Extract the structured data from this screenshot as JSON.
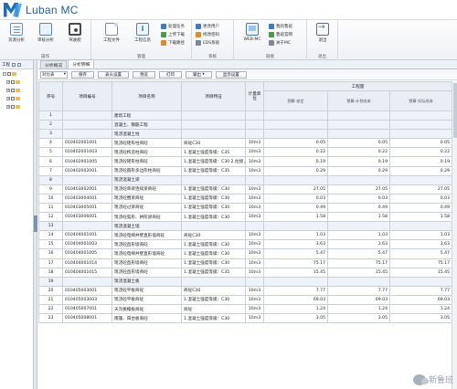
{
  "app": {
    "title": "Luban MC"
  },
  "ribbon": {
    "groups": [
      {
        "label": "操作",
        "buttons": [
          {
            "label": "资源分析"
          },
          {
            "label": "审核分析"
          },
          {
            "label": "驾驶舱"
          }
        ]
      },
      {
        "label": "管理",
        "buttons": [
          {
            "label": "工程文件"
          },
          {
            "label": "工程信息"
          }
        ],
        "small": [
          {
            "label": "处理任务"
          },
          {
            "label": "上传下载"
          },
          {
            "label": "下载路径"
          }
        ]
      },
      {
        "label": "系统",
        "small": [
          {
            "label": "更改用户"
          },
          {
            "label": "修改密码"
          },
          {
            "label": "EDS系统"
          }
        ]
      },
      {
        "label": "链接",
        "buttons": [
          {
            "label": "WEB-MC"
          }
        ],
        "small": [
          {
            "label": "我的鲁班"
          },
          {
            "label": "鲁班官网"
          },
          {
            "label": "关于MC"
          }
        ]
      },
      {
        "label": "退出",
        "buttons": [
          {
            "label": "退出"
          }
        ]
      }
    ]
  },
  "leftpanel": {
    "header": "工程"
  },
  "tabs": [
    {
      "label": "分析概况"
    },
    {
      "label": "分析明细"
    }
  ],
  "toolbar": {
    "select_value": "对比表",
    "buttons": [
      {
        "label": "保存"
      },
      {
        "label": "表头设置"
      },
      {
        "label": "预览"
      },
      {
        "label": "打印"
      },
      {
        "label": "输出"
      },
      {
        "label": "显示设置"
      }
    ]
  },
  "table": {
    "headers": {
      "seq": "序号",
      "code": "项目编号",
      "name": "项目名称",
      "feature": "项目特征",
      "unit": "计量单位",
      "qty_group": "工程量",
      "qty_cols": [
        "预算-核定",
        "预算-计划成本",
        "预算-实际成本"
      ]
    },
    "rows": [
      {
        "seq": "1",
        "code": "",
        "name": "建筑工程",
        "feature": "",
        "unit": "",
        "v1": "",
        "v2": "",
        "v3": "",
        "type": "section"
      },
      {
        "seq": "2",
        "code": "",
        "name": "混凝土、钢筋工程",
        "feature": "",
        "unit": "",
        "v1": "",
        "v2": "",
        "v3": "",
        "type": "section"
      },
      {
        "seq": "3",
        "code": "",
        "name": "现浇混凝土柱",
        "feature": "",
        "unit": "",
        "v1": "",
        "v2": "",
        "v3": "",
        "type": "section"
      },
      {
        "seq": "4",
        "code": "010402001001",
        "name": "现浇砼矩形柱商砼",
        "feature": "商砼C30",
        "unit": "10m3",
        "v1": "0.05",
        "v2": "0.05",
        "v3": "0.05",
        "type": ""
      },
      {
        "seq": "5",
        "code": "010402001003",
        "name": "现浇砼构造柱商砼",
        "feature": "1.混凝土强度等级：C35",
        "unit": "10m3",
        "v1": "0.22",
        "v2": "0.22",
        "v3": "0.22",
        "type": ""
      },
      {
        "seq": "6",
        "code": "010402001005",
        "name": "现浇砼矩形柱商砼",
        "feature": "1.混凝土强度等级：C30 2.拉接，模板柱",
        "unit": "10m3",
        "v1": "0.19",
        "v2": "0.19",
        "v3": "0.19",
        "type": ""
      },
      {
        "seq": "7",
        "code": "010402002001",
        "name": "现浇砼圆形多边形柱商砼",
        "feature": "1.混凝土强度等级：C35",
        "unit": "10m3",
        "v1": "0.29",
        "v2": "0.29",
        "v3": "0.29",
        "type": ""
      },
      {
        "seq": "8",
        "code": "",
        "name": "现浇混凝土梁",
        "feature": "",
        "unit": "",
        "v1": "",
        "v2": "",
        "v3": "",
        "type": "section"
      },
      {
        "seq": "9",
        "code": "010403002001",
        "name": "现浇砼单梁连续梁商砼",
        "feature": "1.混凝土强度等级：C30",
        "unit": "10m3",
        "v1": "27.05",
        "v2": "27.05",
        "v3": "27.05",
        "type": ""
      },
      {
        "seq": "10",
        "code": "010403004001",
        "name": "现浇砼圈梁商砼",
        "feature": "1.混凝土强度等级：C30",
        "unit": "10m3",
        "v1": "0.03",
        "v2": "0.03",
        "v3": "0.03",
        "type": ""
      },
      {
        "seq": "11",
        "code": "010403005001",
        "name": "现浇砼过梁商砼",
        "feature": "1.混凝土强度等级：C30",
        "unit": "10m3",
        "v1": "0.49",
        "v2": "0.49",
        "v3": "0.49",
        "type": ""
      },
      {
        "seq": "12",
        "code": "010403006001",
        "name": "现浇砼弧形、拱形梁商砼",
        "feature": "1.混凝土强度等级：C30",
        "unit": "10m3",
        "v1": "1.58",
        "v2": "1.58",
        "v3": "1.58",
        "type": ""
      },
      {
        "seq": "13",
        "code": "",
        "name": "现浇混凝土墙",
        "feature": "",
        "unit": "",
        "v1": "",
        "v2": "",
        "v3": "",
        "type": "section"
      },
      {
        "seq": "14",
        "code": "010404001001",
        "name": "现浇砼电梯井壁直形墙商砼",
        "feature": "商砼C30",
        "unit": "10m3",
        "v1": "1.03",
        "v2": "1.03",
        "v3": "1.03",
        "type": ""
      },
      {
        "seq": "15",
        "code": "010404001003",
        "name": "现浇砼直形墙商砼",
        "feature": "1.混凝土强度等级：C30",
        "unit": "10m3",
        "v1": "3.63",
        "v2": "3.63",
        "v3": "3.63",
        "type": ""
      },
      {
        "seq": "16",
        "code": "010404001005",
        "name": "现浇砼电梯井壁直形墙商砼",
        "feature": "1.混凝土强度等级：C30",
        "unit": "10m3",
        "v1": "5.47",
        "v2": "5.47",
        "v3": "5.47",
        "type": ""
      },
      {
        "seq": "17",
        "code": "010404001014",
        "name": "现浇砼直形墙商砼",
        "feature": "1.混凝土强度等级：C30",
        "unit": "10m3",
        "v1": "75.17",
        "v2": "75.17",
        "v3": "75.17",
        "type": ""
      },
      {
        "seq": "18",
        "code": "010404001015",
        "name": "现浇砼直形墙商砼",
        "feature": "1.混凝土强度等级：C35",
        "unit": "10m3",
        "v1": "15.45",
        "v2": "15.45",
        "v3": "15.45",
        "type": ""
      },
      {
        "seq": "19",
        "code": "",
        "name": "现浇混凝土板",
        "feature": "",
        "unit": "",
        "v1": "",
        "v2": "",
        "v3": "",
        "type": "section"
      },
      {
        "seq": "20",
        "code": "010405003001",
        "name": "现浇砼平板商砼",
        "feature": "商砼C30",
        "unit": "10m3",
        "v1": "7.77",
        "v2": "7.77",
        "v3": "7.77",
        "type": ""
      },
      {
        "seq": "21",
        "code": "010405003003",
        "name": "现浇砼平板商砼",
        "feature": "1.混凝土强度等级：C30",
        "unit": "10m3",
        "v1": "69.03",
        "v2": "69.03",
        "v3": "69.03",
        "type": ""
      },
      {
        "seq": "22",
        "code": "010405007001",
        "name": "天沟挑檐板商砼",
        "feature": "商砼",
        "unit": "10m3",
        "v1": "1.24",
        "v2": "1.24",
        "v3": "1.24",
        "type": ""
      },
      {
        "seq": "23",
        "code": "010405008001",
        "name": "雨篷、阳台板商砼",
        "feature": "1.混凝土强度等级：C30",
        "unit": "10m3",
        "v1": "3.05",
        "v2": "3.05",
        "v3": "3.05",
        "type": ""
      }
    ]
  },
  "watermark": {
    "text": "新鲁班"
  }
}
